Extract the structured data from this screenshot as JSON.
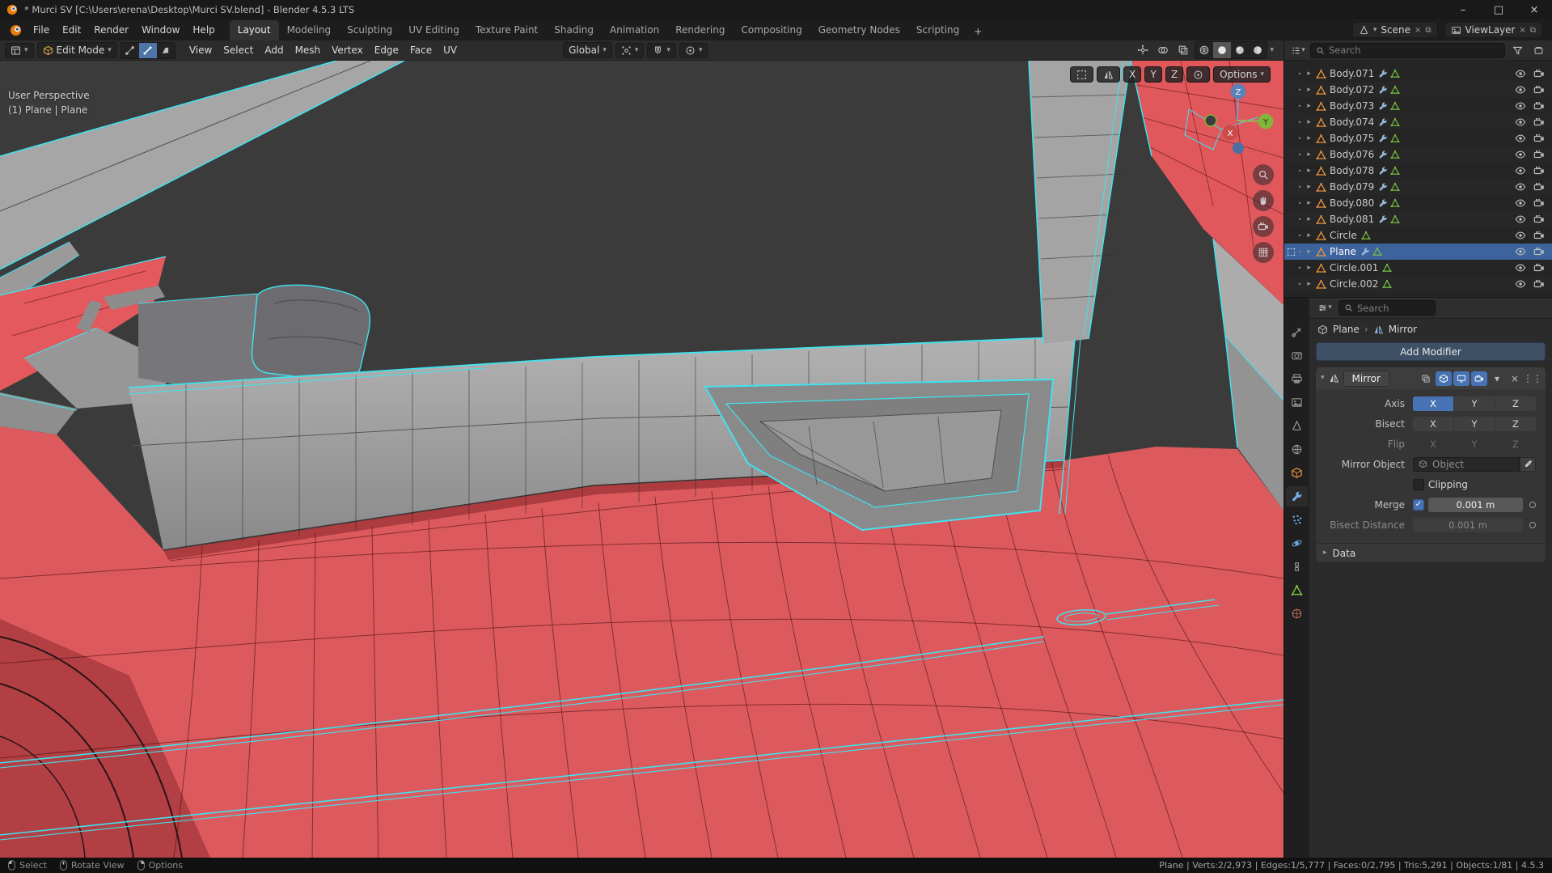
{
  "titlebar": {
    "title": "* Murci SV [C:\\Users\\erena\\Desktop\\Murci SV.blend] - Blender 4.5.3 LTS",
    "minimize": "–",
    "maximize": "□",
    "close": "×"
  },
  "topbar": {
    "menus": [
      "File",
      "Edit",
      "Render",
      "Window",
      "Help"
    ],
    "workspaces": [
      "Layout",
      "Modeling",
      "Sculpting",
      "UV Editing",
      "Texture Paint",
      "Shading",
      "Animation",
      "Rendering",
      "Compositing",
      "Geometry Nodes",
      "Scripting"
    ],
    "active_workspace": "Layout",
    "new_workspace": "+",
    "scene_label": "Scene",
    "viewlayer_label": "ViewLayer"
  },
  "header": {
    "mode": "Edit Mode",
    "menus": [
      "View",
      "Select",
      "Add",
      "Mesh",
      "Vertex",
      "Edge",
      "Face",
      "UV"
    ],
    "orientation": "Global",
    "tool_settings": {
      "axes": [
        "X",
        "Y",
        "Z"
      ],
      "options_label": "Options"
    }
  },
  "viewport": {
    "perspective_label": "User Perspective",
    "context_label": "(1) Plane | Plane",
    "gizmo": {
      "x": "X",
      "y": "Y",
      "z": "Z"
    }
  },
  "outliner": {
    "search_placeholder": "Search",
    "items": [
      {
        "label": "Body.071"
      },
      {
        "label": "Body.072"
      },
      {
        "label": "Body.073"
      },
      {
        "label": "Body.074"
      },
      {
        "label": "Body.075"
      },
      {
        "label": "Body.076"
      },
      {
        "label": "Body.078"
      },
      {
        "label": "Body.079"
      },
      {
        "label": "Body.080"
      },
      {
        "label": "Body.081"
      },
      {
        "label": "Circle"
      },
      {
        "label": "Plane",
        "selected": true
      },
      {
        "label": "Circle.001"
      },
      {
        "label": "Circle.002"
      }
    ]
  },
  "properties": {
    "search_placeholder": "Search",
    "breadcrumb": {
      "object": "Plane",
      "separator": "›",
      "modifier": "Mirror"
    },
    "add_modifier_label": "Add Modifier",
    "modifier": {
      "name": "Mirror",
      "axis_label": "Axis",
      "bisect_label": "Bisect",
      "flip_label": "Flip",
      "axes": [
        "X",
        "Y",
        "Z"
      ],
      "active_axis": "X",
      "mirror_object_label": "Mirror Object",
      "object_placeholder": "Object",
      "clipping_label": "Clipping",
      "merge_label": "Merge",
      "merge_value": "0.001 m",
      "bisect_distance_label": "Bisect Distance",
      "bisect_distance_value": "0.001 m",
      "data_panel_label": "Data"
    }
  },
  "statusbar": {
    "hints": [
      {
        "label": "Select"
      },
      {
        "label": "Rotate View"
      },
      {
        "label": "Options"
      }
    ],
    "stats": "Plane | Verts:2/2,973 | Edges:1/5,777 | Faces:0/2,795 | Tris:5,291 | Objects:1/81 | 4.5.3"
  },
  "colors": {
    "accent": "#4772b3",
    "selection_red": "#dd5a5e",
    "edge_cyan": "#3fe3ef",
    "object_orange": "#e8923c",
    "mesh_green": "#79c141"
  }
}
